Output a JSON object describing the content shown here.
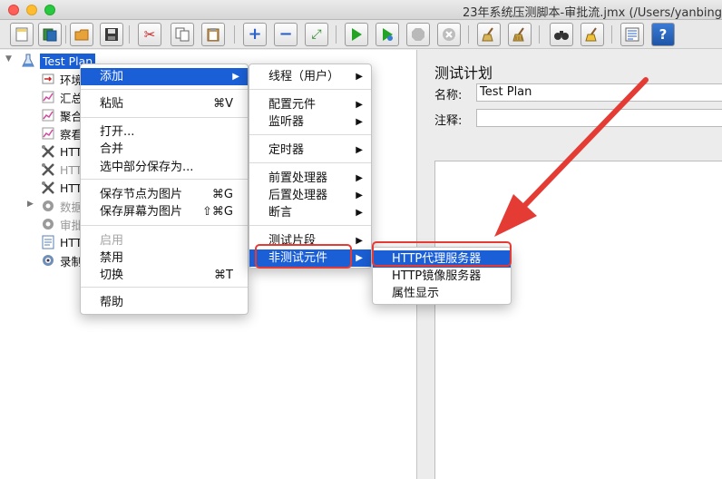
{
  "window": {
    "title": "23年系统压测脚本-审批流.jmx (/Users/yanbing"
  },
  "toolbar": {
    "buttons": [
      {
        "name": "new-icon",
        "glyph": "▭"
      },
      {
        "name": "templates-icon",
        "glyph": "▤"
      },
      {
        "name": "open-icon",
        "glyph": "▰"
      },
      {
        "name": "save-icon",
        "glyph": "▣"
      },
      {
        "name": "cut-icon",
        "glyph": "✂"
      },
      {
        "name": "copy-icon",
        "glyph": "❐"
      },
      {
        "name": "paste-icon",
        "glyph": "📋"
      },
      {
        "name": "expand-icon",
        "glyph": "+"
      },
      {
        "name": "collapse-icon",
        "glyph": "−"
      },
      {
        "name": "toggle-icon",
        "glyph": "⤢"
      },
      {
        "name": "start-icon",
        "glyph": "▶"
      },
      {
        "name": "start-no-pause-icon",
        "glyph": "▶"
      },
      {
        "name": "stop-icon",
        "glyph": "⬣"
      },
      {
        "name": "shutdown-icon",
        "glyph": "✖"
      },
      {
        "name": "clear-icon",
        "glyph": "🧹"
      },
      {
        "name": "clear-all-icon",
        "glyph": "🧹"
      },
      {
        "name": "search-icon",
        "glyph": "👓"
      },
      {
        "name": "reset-search-icon",
        "glyph": "🧹"
      },
      {
        "name": "function-helper-icon",
        "glyph": "☰"
      },
      {
        "name": "help-icon",
        "glyph": "?"
      }
    ]
  },
  "tree": {
    "root": "Test Plan",
    "items": [
      {
        "label": "环境",
        "icon": "config-icon",
        "dim": false
      },
      {
        "label": "汇总",
        "icon": "chart-icon",
        "dim": false
      },
      {
        "label": "聚合",
        "icon": "chart-icon",
        "dim": false
      },
      {
        "label": "察看",
        "icon": "chart-icon",
        "dim": false
      },
      {
        "label": "HTT",
        "icon": "tools-icon",
        "dim": false
      },
      {
        "label": "HTT",
        "icon": "tools-icon",
        "dim": true
      },
      {
        "label": "HTT",
        "icon": "tools-icon",
        "dim": false
      },
      {
        "label": "数据",
        "icon": "gear-icon",
        "dim": true
      },
      {
        "label": "审批",
        "icon": "gear-icon",
        "dim": true
      },
      {
        "label": "HTT",
        "icon": "http-icon",
        "dim": false
      },
      {
        "label": "录制",
        "icon": "record-icon",
        "dim": false
      }
    ]
  },
  "right_pane": {
    "title": "测试计划",
    "name_label": "名称:",
    "name_value": "Test Plan",
    "comment_label": "注释:",
    "comment_value": ""
  },
  "context_menu": {
    "items": [
      {
        "label": "添加",
        "shortcut": "",
        "submenu": true,
        "highlighted": true
      },
      {
        "label": "粘贴",
        "shortcut": "⌘V"
      },
      {
        "label": "打开...",
        "shortcut": ""
      },
      {
        "label": "合并",
        "shortcut": ""
      },
      {
        "label": "选中部分保存为...",
        "shortcut": ""
      },
      {
        "label": "保存节点为图片",
        "shortcut": "⌘G"
      },
      {
        "label": "保存屏幕为图片",
        "shortcut": "⇧⌘G"
      },
      {
        "label": "启用",
        "shortcut": "",
        "disabled": true
      },
      {
        "label": "禁用",
        "shortcut": ""
      },
      {
        "label": "切换",
        "shortcut": "⌘T"
      },
      {
        "label": "帮助",
        "shortcut": ""
      }
    ]
  },
  "add_submenu": {
    "items": [
      {
        "label": "线程（用户）",
        "submenu": true
      },
      {
        "label": "配置元件",
        "submenu": true
      },
      {
        "label": "监听器",
        "submenu": true
      },
      {
        "label": "定时器",
        "submenu": true
      },
      {
        "label": "前置处理器",
        "submenu": true
      },
      {
        "label": "后置处理器",
        "submenu": true
      },
      {
        "label": "断言",
        "submenu": true
      },
      {
        "label": "测试片段",
        "submenu": true
      },
      {
        "label": "非测试元件",
        "submenu": true,
        "highlighted": true
      }
    ]
  },
  "non_test_submenu": {
    "items": [
      {
        "label": "HTTP代理服务器",
        "highlighted": true
      },
      {
        "label": "HTTP镜像服务器"
      },
      {
        "label": "属性显示"
      }
    ]
  },
  "colors": {
    "highlight": "#1a5fd6",
    "annotation_red": "#e53b35"
  }
}
